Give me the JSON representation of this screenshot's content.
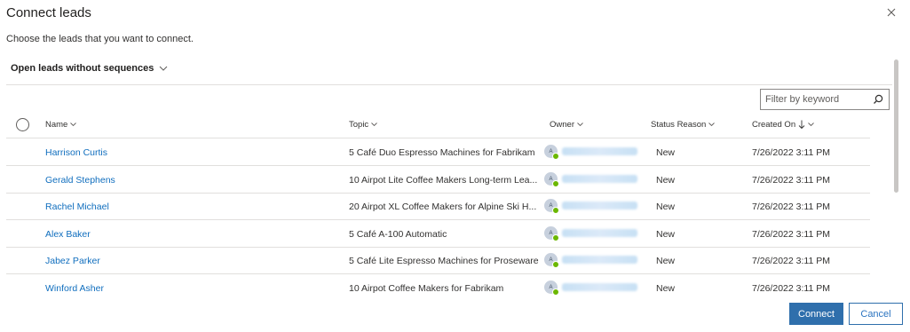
{
  "dialog": {
    "title": "Connect leads",
    "subtitle": "Choose the leads that you want to connect.",
    "view_name": "Open leads without sequences",
    "filter_placeholder": "Filter by keyword",
    "primary_button": "Connect",
    "secondary_button": "Cancel"
  },
  "grid": {
    "headers": [
      "Name",
      "Topic",
      "Owner",
      "Status Reason",
      "Created On"
    ],
    "sorted_column": "Created On",
    "sort_direction": "descending",
    "rows": [
      {
        "name": "Harrison Curtis",
        "topic": "5 Café Duo Espresso Machines for Fabrikam",
        "owner_initials": "A",
        "status": "New",
        "created": "7/26/2022 3:11 PM"
      },
      {
        "name": "Gerald Stephens",
        "topic": "10 Airpot Lite Coffee Makers Long-term Lea...",
        "owner_initials": "A",
        "status": "New",
        "created": "7/26/2022 3:11 PM"
      },
      {
        "name": "Rachel Michael",
        "topic": "20 Airpot XL Coffee Makers for Alpine Ski H...",
        "owner_initials": "A",
        "status": "New",
        "created": "7/26/2022 3:11 PM"
      },
      {
        "name": "Alex Baker",
        "topic": "5 Café A-100 Automatic",
        "owner_initials": "A",
        "status": "New",
        "created": "7/26/2022 3:11 PM"
      },
      {
        "name": "Jabez Parker",
        "topic": "5 Café Lite Espresso Machines for Proseware",
        "owner_initials": "A",
        "status": "New",
        "created": "7/26/2022 3:11 PM"
      },
      {
        "name": "Winford Asher",
        "topic": "10 Airpot Coffee Makers for Fabrikam",
        "owner_initials": "A",
        "status": "New",
        "created": "7/26/2022 3:11 PM"
      }
    ]
  },
  "colors": {
    "link": "#106ebe",
    "primary": "#2f6fac",
    "presence": "#6bb700"
  },
  "icons": {
    "close": "close-icon",
    "search": "search-icon",
    "chevron": "chevron-down-icon",
    "sort": "sort-descending-icon",
    "presence": "presence-available-icon"
  }
}
